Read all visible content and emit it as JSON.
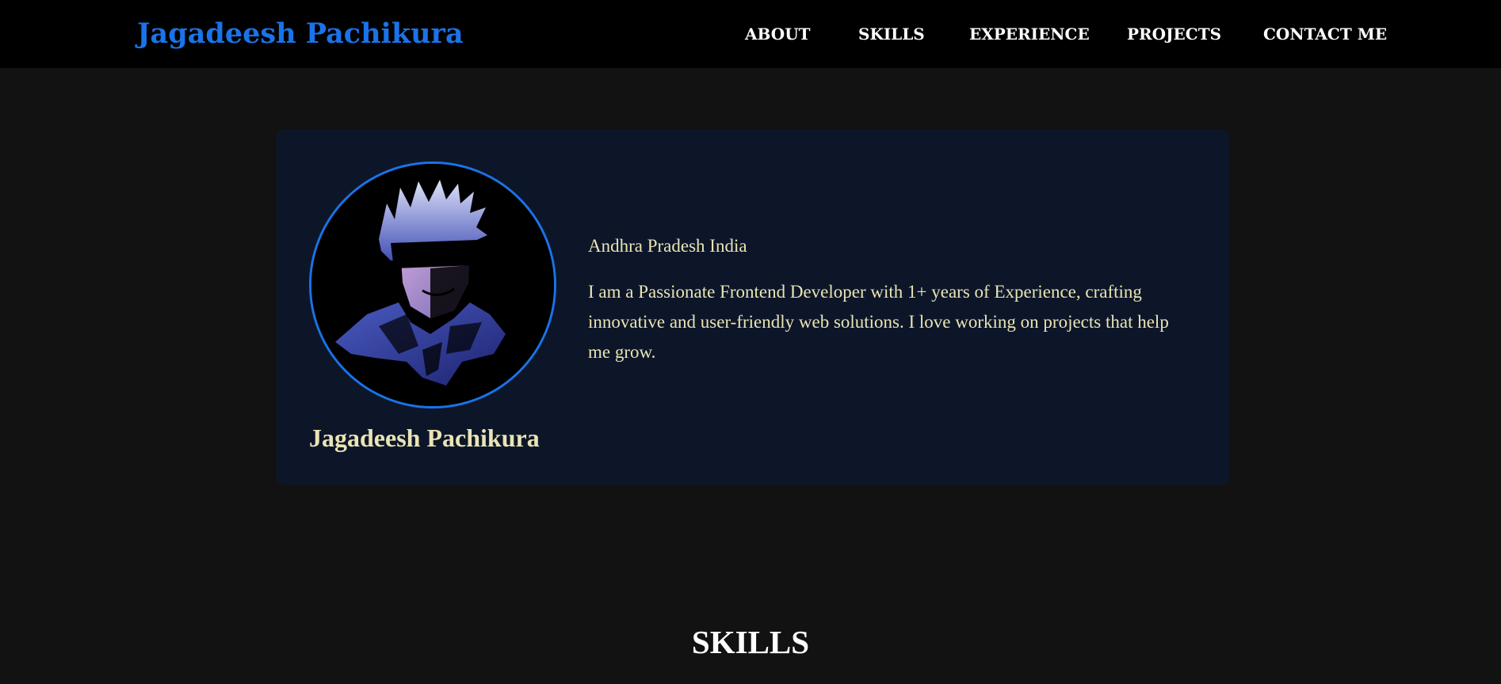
{
  "navbar": {
    "brand": "Jagadeesh Pachikura",
    "links": [
      {
        "label": "ABOUT"
      },
      {
        "label": "SKILLS"
      },
      {
        "label": "EXPERIENCE"
      },
      {
        "label": "PROJECTS"
      },
      {
        "label": "CONTACT ME"
      }
    ]
  },
  "profile": {
    "name": "Jagadeesh Pachikura",
    "location": "Andhra Pradesh India",
    "bio": "I am a Passionate Frontend Developer with 1+ years of Experience, crafting innovative and user-friendly web solutions. I love working on projects that help me grow.",
    "avatar_icon": "avatar-illustration"
  },
  "skills_section": {
    "title": "SKILLS"
  },
  "colors": {
    "brand": "#1a73e8",
    "navbar_bg": "#000000",
    "page_bg": "#121212",
    "card_bg": "#0d1629",
    "accent_text": "#e9e4b5"
  }
}
